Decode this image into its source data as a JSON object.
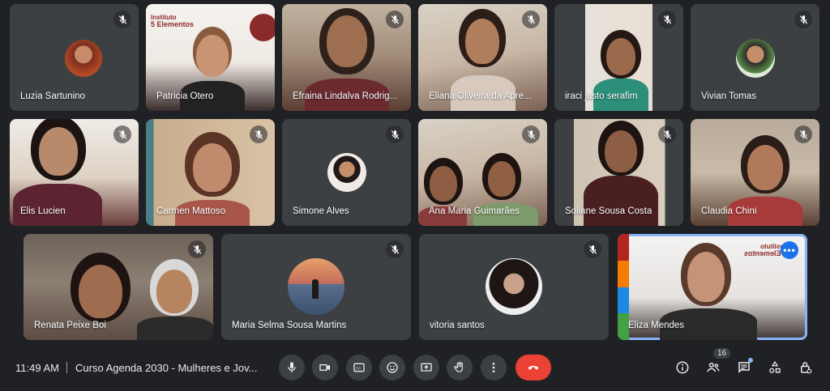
{
  "participants": [
    {
      "name": "Luzia Sartunino"
    },
    {
      "name": "Patricia Otero"
    },
    {
      "name": "Efraina Lindalva Rodrig..."
    },
    {
      "name": "Eliana Oliveira da Apre..."
    },
    {
      "name": "iraci justo serafim"
    },
    {
      "name": "Vivian Tomas"
    },
    {
      "name": "Elis Lucien"
    },
    {
      "name": "Carmen Mattoso"
    },
    {
      "name": "Simone Alves"
    },
    {
      "name": "Ana Maria Guimarães"
    },
    {
      "name": "Soliane Sousa Costa"
    },
    {
      "name": "Claudia Chini"
    },
    {
      "name": "Renata Peixe Boi"
    },
    {
      "name": "Maria Selma Sousa Martins"
    },
    {
      "name": "vitoria santos"
    },
    {
      "name": "Eliza Mendes"
    }
  ],
  "logo": {
    "line1": "Instituto",
    "line2": "5 Elementos"
  },
  "bar": {
    "time": "11:49 AM",
    "meeting_title": "Curso Agenda 2030 - Mulheres e Jov...",
    "participant_count": "16"
  },
  "icons": {
    "mute": "mic-off-icon",
    "controls": [
      "mic-icon",
      "camera-icon",
      "captions-icon",
      "emoji-icon",
      "present-icon",
      "raise-hand-icon",
      "more-vert-icon",
      "end-call-icon"
    ],
    "side": [
      "info-icon",
      "people-icon",
      "chat-icon",
      "activities-icon",
      "host-controls-icon"
    ]
  },
  "colors": {
    "background": "#202124",
    "tile": "#3c4043",
    "active_outline": "#8ab4f8",
    "end_call": "#ea4335"
  }
}
